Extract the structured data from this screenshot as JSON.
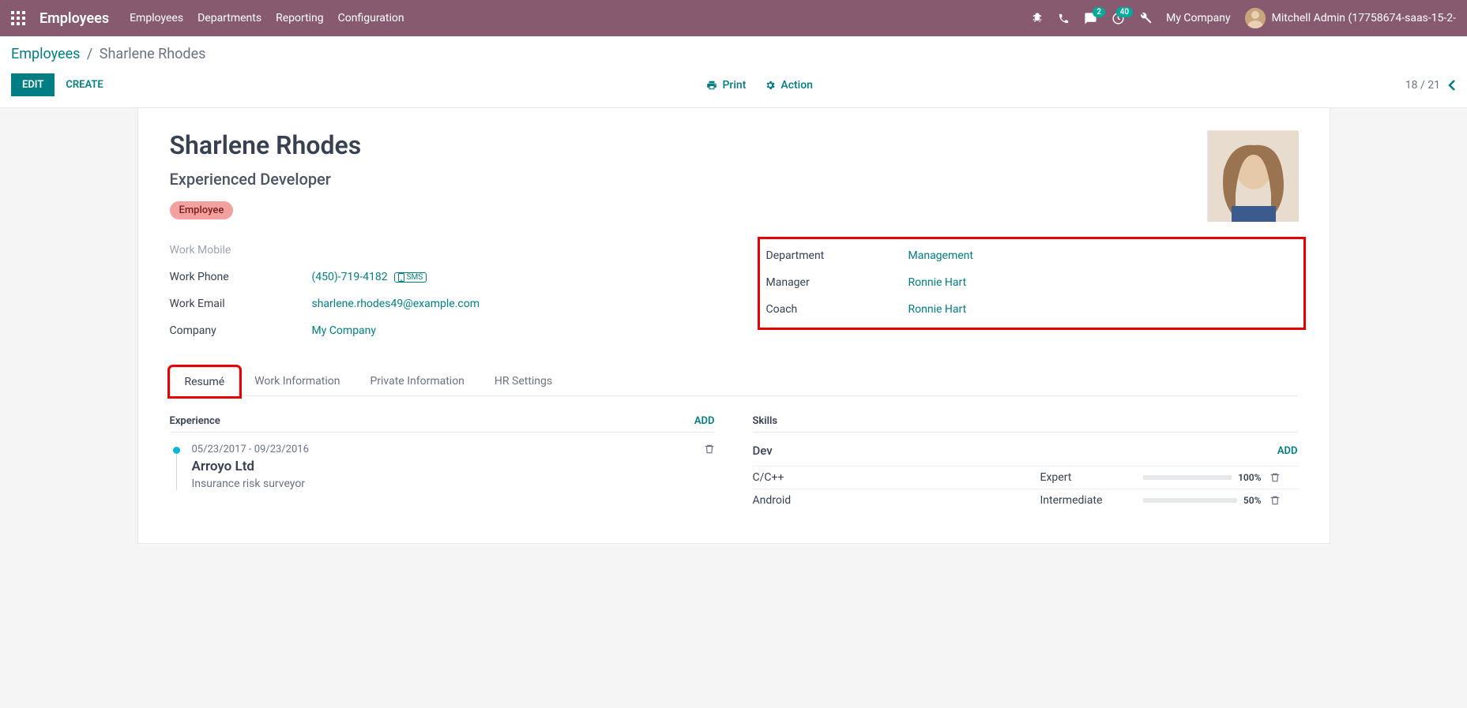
{
  "nav": {
    "brand": "Employees",
    "items": [
      "Employees",
      "Departments",
      "Reporting",
      "Configuration"
    ],
    "msg_badge": "2",
    "activity_badge": "40",
    "company": "My Company",
    "user": "Mitchell Admin (17758674-saas-15-2-"
  },
  "breadcrumb": {
    "root": "Employees",
    "current": "Sharlene Rhodes"
  },
  "toolbar": {
    "edit": "EDIT",
    "create": "CREATE",
    "print": "Print",
    "action": "Action",
    "pager": "18 / 21"
  },
  "emp": {
    "name": "Sharlene Rhodes",
    "title": "Experienced Developer",
    "badge": "Employee"
  },
  "left": {
    "work_mobile_label": "Work Mobile",
    "work_phone_label": "Work Phone",
    "work_phone": "(450)-719-4182",
    "sms": "SMS",
    "work_email_label": "Work Email",
    "work_email": "sharlene.rhodes49@example.com",
    "company_label": "Company",
    "company": "My Company"
  },
  "right": {
    "department_label": "Department",
    "department": "Management",
    "manager_label": "Manager",
    "manager": "Ronnie Hart",
    "coach_label": "Coach",
    "coach": "Ronnie Hart"
  },
  "tabs": [
    "Resumé",
    "Work Information",
    "Private Information",
    "HR Settings"
  ],
  "experience": {
    "title": "Experience",
    "add": "ADD",
    "items": [
      {
        "dates": "05/23/2017 - 09/23/2016",
        "company": "Arroyo Ltd",
        "role": "Insurance risk surveyor"
      }
    ]
  },
  "skills": {
    "title": "Skills",
    "add": "ADD",
    "group": "Dev",
    "rows": [
      {
        "name": "C/C++",
        "level": "Expert",
        "pct": "100%",
        "fill": 100
      },
      {
        "name": "Android",
        "level": "Intermediate",
        "pct": "50%",
        "fill": 50
      }
    ]
  }
}
